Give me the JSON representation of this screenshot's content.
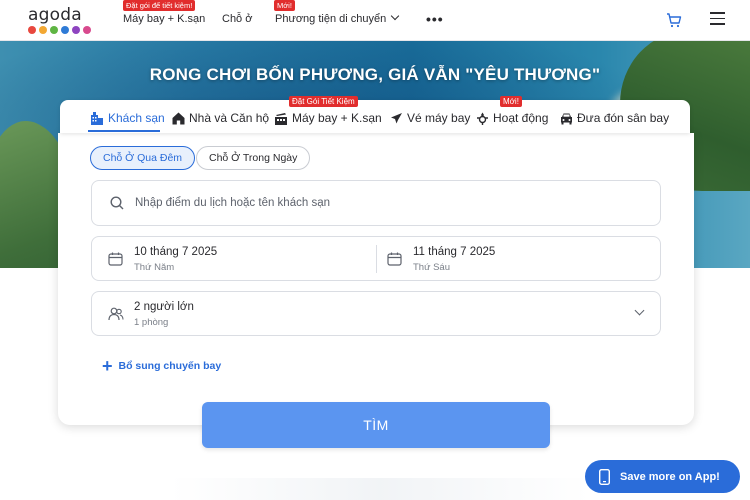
{
  "header": {
    "logo_text": "agoda",
    "logo_dot_colors": [
      "#e8483f",
      "#f3a833",
      "#5fb543",
      "#2f7bd6",
      "#8e44c0",
      "#d84a8e"
    ],
    "nav": [
      {
        "label": "Máy bay + K.sạn",
        "badge": "Đặt gói để tiết kiệm!"
      },
      {
        "label": "Chỗ ở",
        "badge": ""
      },
      {
        "label": "Phương tiện di chuyển",
        "badge": "Mới!"
      }
    ],
    "more_icon": "more-dots-icon",
    "cart_icon": "cart-icon",
    "menu_icon": "hamburger-menu-icon"
  },
  "hero": {
    "title": "RONG CHƠI BỐN PHƯƠNG, GIÁ VẪN \"YÊU THƯƠNG\""
  },
  "tabs": [
    {
      "label": "Khách sạn",
      "icon": "hotel-icon",
      "active": true,
      "badge": ""
    },
    {
      "label": "Nhà và Căn hộ",
      "icon": "house-icon",
      "active": false,
      "badge": ""
    },
    {
      "label": "Máy bay + K.sạn",
      "icon": "flight-hotel-icon",
      "active": false,
      "badge": "Đặt Gói Tiết Kiệm"
    },
    {
      "label": "Vé máy bay",
      "icon": "plane-icon",
      "active": false,
      "badge": ""
    },
    {
      "label": "Hoạt động",
      "icon": "activities-icon",
      "active": false,
      "badge": "Mới!"
    },
    {
      "label": "Đưa đón sân bay",
      "icon": "car-icon",
      "active": false,
      "badge": ""
    }
  ],
  "stay_type": {
    "overnight": "Chỗ Ở Qua Đêm",
    "day_use": "Chỗ Ở Trong Ngày",
    "selected": "overnight"
  },
  "search": {
    "placeholder": "Nhập điểm du lịch hoặc tên khách sạn"
  },
  "dates": {
    "checkin": {
      "date": "10 tháng 7 2025",
      "weekday": "Thứ Năm"
    },
    "checkout": {
      "date": "11 tháng 7 2025",
      "weekday": "Thứ Sáu"
    }
  },
  "guests": {
    "adults": "2 người lớn",
    "rooms": "1 phòng"
  },
  "add_flight": "Bổ sung chuyến bay",
  "search_button": "TÌM",
  "app_button": "Save more on App!",
  "colors": {
    "accent": "#2a6cd9",
    "search_button": "#5b95f0",
    "badge": "#e12d2d"
  }
}
